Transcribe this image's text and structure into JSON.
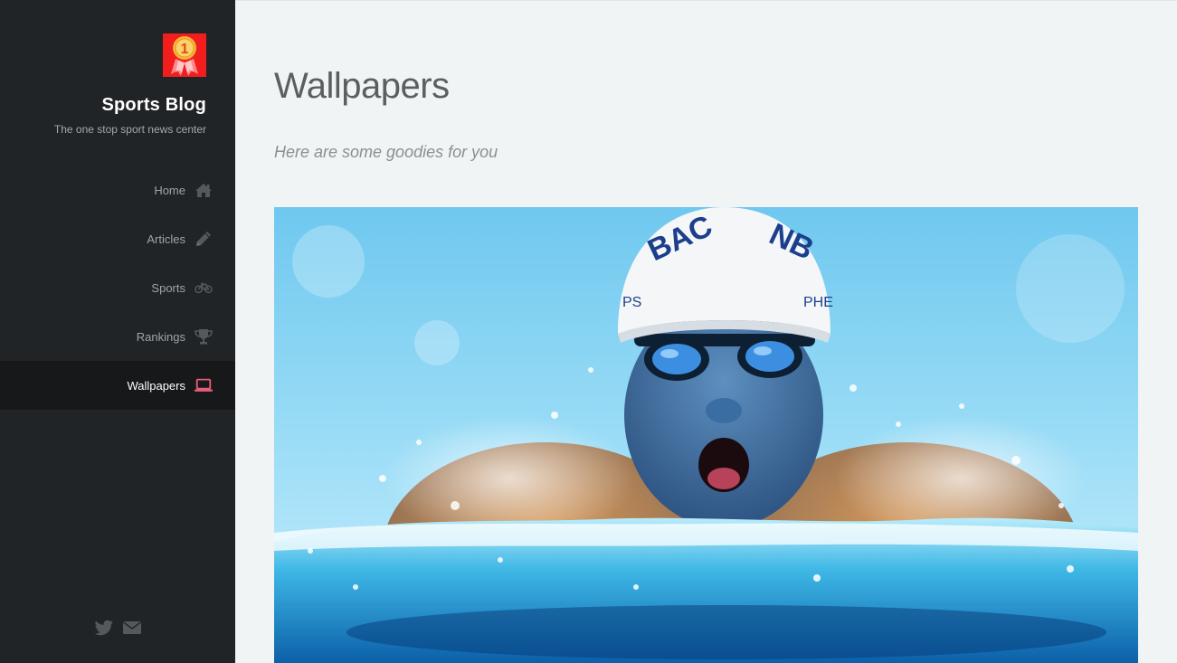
{
  "site": {
    "title": "Sports Blog",
    "tagline": "The one stop sport news center",
    "logo_icon": "medal-number-one-icon",
    "logo_text": "1"
  },
  "nav": {
    "items": [
      {
        "label": "Home",
        "icon": "home-icon",
        "active": false
      },
      {
        "label": "Articles",
        "icon": "pencil-icon",
        "active": false
      },
      {
        "label": "Sports",
        "icon": "bicycle-icon",
        "active": false
      },
      {
        "label": "Rankings",
        "icon": "trophy-icon",
        "active": false
      },
      {
        "label": "Wallpapers",
        "icon": "laptop-icon",
        "active": true
      }
    ]
  },
  "social": {
    "icons": [
      "twitter-icon",
      "envelope-icon"
    ]
  },
  "main": {
    "title": "Wallpapers",
    "subtitle": "Here are some goodies for you",
    "image_subject": "swimmer-wallpaper",
    "cap_text_left": "BAC",
    "cap_text_right": "NB",
    "cap_name_left": "PS",
    "cap_name_right": "PHE"
  },
  "colors": {
    "sidebar_bg": "#212427",
    "sidebar_active_bg": "#161819",
    "accent": "#e95d78",
    "main_bg": "#f1f4f4",
    "logo_red": "#f21d1d",
    "medal_gold": "#f5b43a"
  }
}
